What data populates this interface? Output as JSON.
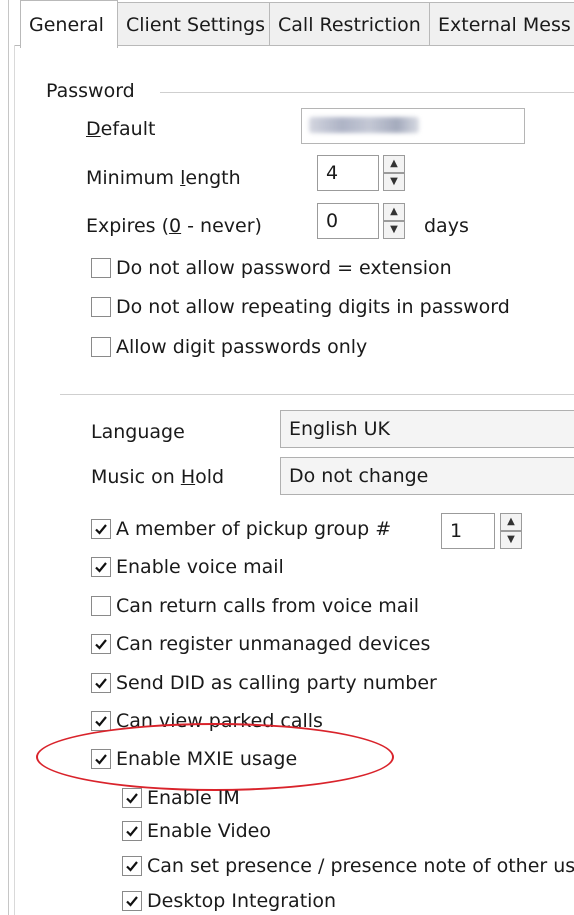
{
  "tabs": [
    "General",
    "Client Settings",
    "Call Restriction",
    "External Mess"
  ],
  "password": {
    "group_label": "Password",
    "default_label": "Default",
    "min_length_label": "Minimum length",
    "min_length_value": "4",
    "expires_label": "Expires (0 - never)",
    "expires_value": "0",
    "expires_unit": "days",
    "checkboxes": [
      {
        "label": "Do not allow password = extension",
        "checked": false
      },
      {
        "label": "Do not allow repeating digits in password",
        "checked": false
      },
      {
        "label": "Allow digit passwords only",
        "checked": false
      }
    ]
  },
  "settings": {
    "language_label": "Language",
    "language_value": "English UK",
    "moh_label": "Music on Hold",
    "moh_value": "Do not change",
    "pickup_value": "1",
    "checkboxes": [
      {
        "label": "A member of pickup group #",
        "checked": true
      },
      {
        "label": "Enable voice mail",
        "checked": true
      },
      {
        "label": "Can return calls from voice mail",
        "checked": false
      },
      {
        "label": "Can register unmanaged devices",
        "checked": true
      },
      {
        "label": "Send DID as calling party number",
        "checked": true
      },
      {
        "label": "Can view parked calls",
        "checked": true
      },
      {
        "label": "Enable MXIE usage",
        "checked": true
      }
    ],
    "mxie_sub": [
      {
        "label": "Enable IM",
        "checked": true
      },
      {
        "label": "Enable Video",
        "checked": true
      },
      {
        "label": "Can set presence / presence note of other us",
        "checked": true
      },
      {
        "label": "Desktop Integration",
        "checked": true
      }
    ]
  },
  "icons": {
    "check": "check-icon",
    "spin_up": "spin-up-icon",
    "spin_down": "spin-down-icon"
  },
  "colors": {
    "highlight_ellipse": "#d9232b"
  }
}
